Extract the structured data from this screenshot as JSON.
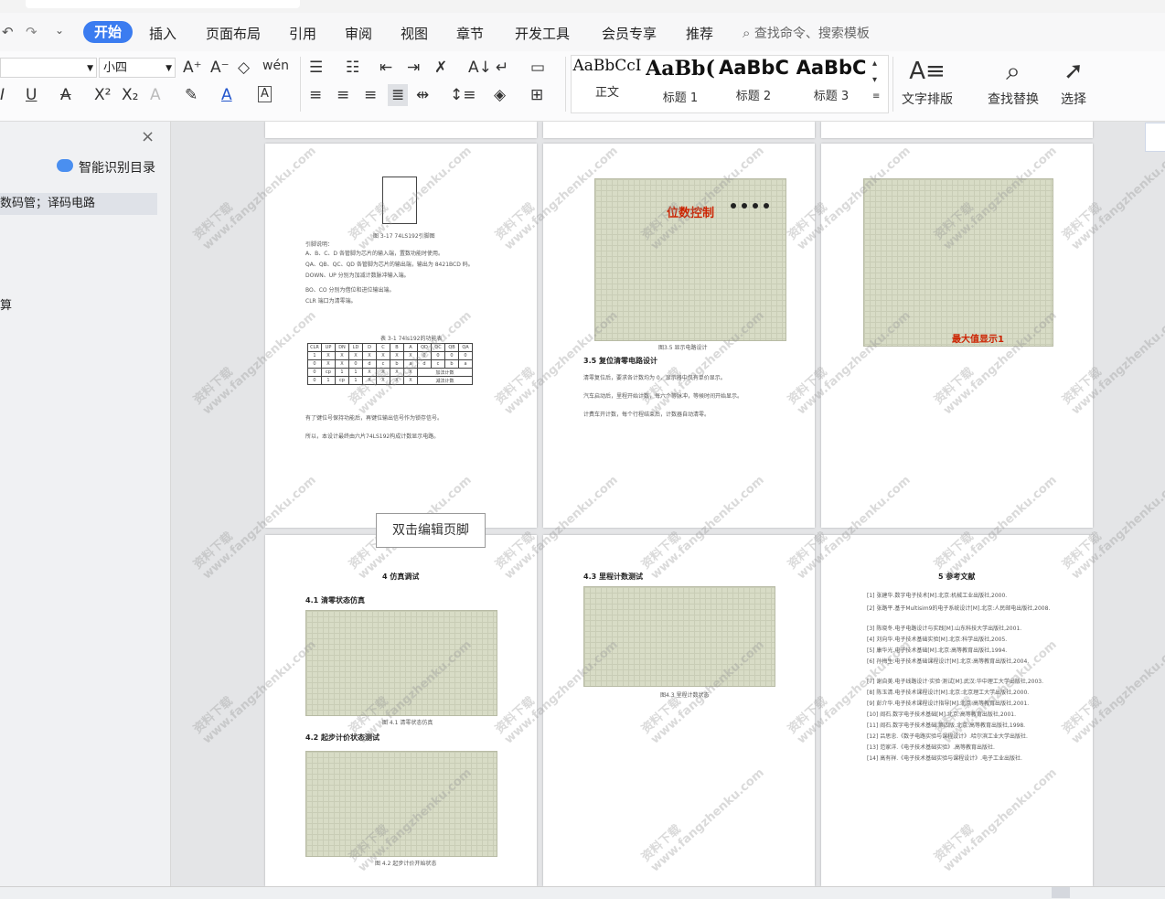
{
  "menu": {
    "tabs": [
      "开始",
      "插入",
      "页面布局",
      "引用",
      "审阅",
      "视图",
      "章节",
      "开发工具",
      "会员专享",
      "推荐"
    ],
    "search_placeholder": "查找命令、搜索模板"
  },
  "ribbon": {
    "font_size": "小四",
    "styles": [
      {
        "sample": "AaBbCcI",
        "label": "正文"
      },
      {
        "sample": "AaBb(",
        "label": "标题 1"
      },
      {
        "sample": "AaBbC",
        "label": "标题 2"
      },
      {
        "sample": "AaBbC",
        "label": "标题 3"
      }
    ],
    "text_layout_label": "文字排版",
    "find_replace_label": "查找替换",
    "select_label": "选择"
  },
  "nav": {
    "title": "智能识别目录",
    "item": "数码管；译码电路",
    "side_char": "算"
  },
  "pages": {
    "p2_caption": "位数控制",
    "p2_section": "3.5 复位清零电路设计",
    "p3_caption": "最大值显示1",
    "p4_title": "4 仿真调试",
    "p4_s1": "4.1 清零状态仿真",
    "p4_s2": "4.2 起步计价状态测试",
    "p5_s": "4.3 里程计数测试",
    "p6_title": "5 参考文献",
    "table_caption": "表 3-1 74ls192的功能表",
    "fig1": "图 3-17 74LS192引脚图",
    "fig_p2": "图3.5 显示电路设计",
    "fig_41": "图 4.1 清零状态仿真",
    "fig_42": "图 4.2 起步计价开始状态",
    "fig_43": "图4.3 里程计数状态"
  },
  "footer_tip": "双击编辑页脚",
  "watermark_cn": "资料下载",
  "watermark_url": "www.fangzhenku.com",
  "colors": {
    "accent": "#3b7cf0",
    "circuit_label": "#cc2200"
  }
}
